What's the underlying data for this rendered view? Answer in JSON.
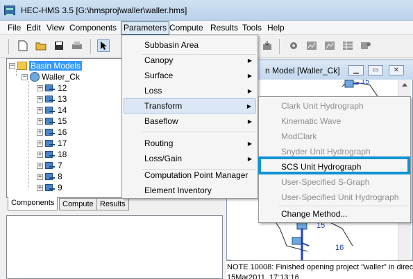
{
  "window": {
    "title": "HEC-HMS 3.5 [G:\\hmsproj\\waller\\waller.hms]"
  },
  "menubar": [
    "File",
    "Edit",
    "View",
    "Components",
    "Parameters",
    "Compute",
    "Results",
    "Tools",
    "Help"
  ],
  "tree": {
    "root": "Basin Models",
    "basin": "Waller_Ck",
    "subbasins": [
      "12",
      "13",
      "14",
      "15",
      "16",
      "17",
      "18",
      "7",
      "8",
      "9"
    ]
  },
  "tabs": [
    "Components",
    "Compute",
    "Results"
  ],
  "child_window": {
    "title": "n Model [Waller_Ck]",
    "map_labels": [
      "15",
      "15",
      "16",
      "15"
    ]
  },
  "status": {
    "line1": "NOTE 10008:  Finished opening project \"waller\" in director",
    "line2": "15Mar2011, 17:13:16"
  },
  "parameters_menu": [
    {
      "label": "Subbasin Area"
    },
    {
      "label": "Canopy",
      "submenu": true
    },
    {
      "label": "Surface",
      "submenu": true
    },
    {
      "label": "Loss",
      "submenu": true
    },
    {
      "label": "Transform",
      "submenu": true
    },
    {
      "label": "Baseflow",
      "submenu": true
    },
    {
      "label": "Routing",
      "submenu": true
    },
    {
      "label": "Loss/Gain",
      "submenu": true
    },
    {
      "label": "Computation Point Manager"
    },
    {
      "label": "Element Inventory"
    }
  ],
  "transform_menu": [
    {
      "label": "Clark Unit Hydrograph",
      "enabled": false
    },
    {
      "label": "Kinematic Wave",
      "enabled": false
    },
    {
      "label": "ModClark",
      "enabled": false
    },
    {
      "label": "Snyder Unit Hydrograph",
      "enabled": false
    },
    {
      "label": "SCS Unit Hydrograph",
      "enabled": true,
      "selected": true
    },
    {
      "label": "User-Specified S-Graph",
      "enabled": false
    },
    {
      "label": "User-Specified Unit Hydrograph",
      "enabled": false
    },
    {
      "label": "Change Method...",
      "enabled": true
    }
  ],
  "colors": {
    "highlight_box": "#1192d4",
    "tree_selection": "#3399ff"
  }
}
